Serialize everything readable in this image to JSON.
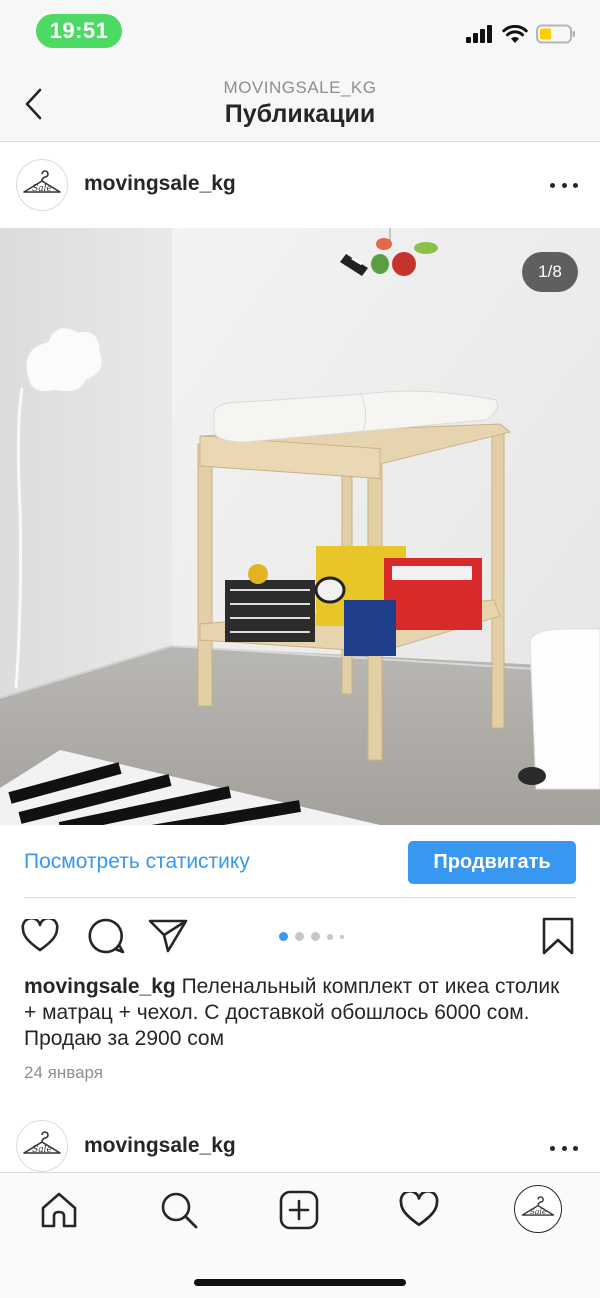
{
  "status_bar": {
    "time": "19:51",
    "battery_color": "#ffcc00",
    "time_pill_color": "#4cd964"
  },
  "header": {
    "subtitle": "MOVINGSALE_KG",
    "title": "Публикации",
    "back_icon": "chevron-left-icon"
  },
  "post": {
    "username": "movingsale_kg",
    "avatar_text": "Sale",
    "image_counter": "1/8",
    "insights": {
      "view_stats_label": "Посмотреть статистику",
      "promote_label": "Продвигать"
    },
    "carousel": {
      "total_dots": 5,
      "active_index": 0
    },
    "caption": {
      "username": "movingsale_kg",
      "text": "Пеленальный комплект от икеа столик + матрац + чехол. С доставкой обошлось 6000 сом. Продаю за 2900 сом"
    },
    "date": "24 января"
  },
  "next_post": {
    "username": "movingsale_kg"
  },
  "tab_bar": {
    "items": [
      {
        "icon": "home-icon"
      },
      {
        "icon": "search-icon"
      },
      {
        "icon": "add-post-icon"
      },
      {
        "icon": "heart-icon"
      },
      {
        "icon": "profile-avatar"
      }
    ]
  },
  "colors": {
    "accent": "#3897f0",
    "text": "#262626",
    "muted": "#8e8e8e"
  }
}
